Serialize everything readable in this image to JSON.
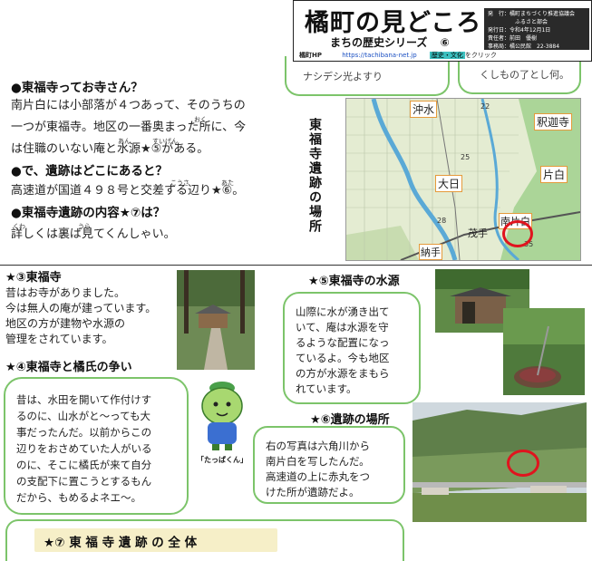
{
  "masthead": {
    "title": "橘町の見どころ",
    "series": "まちの歴史シリーズ",
    "number": "⑥",
    "hp_label": "橘町HP",
    "url": "https://tachibana-net.jp",
    "tag": "歴史・文化",
    "tag_suffix": "をクリック",
    "info": [
      "発　行：橘町まちづくり推進協議会",
      "ふるさと部会",
      "発行日：令和4年12月1日",
      "責任者：前田　優樹",
      "事務局：橘公民館　22-3884"
    ]
  },
  "top_fragments": {
    "left": "ナシデシ光よすり",
    "right": "くしもの了とし何。"
  },
  "intro": {
    "q1_title": "●東福寺ってお寺さん？",
    "q1_line1": "南片白には小部落が４つあって、そのうちの",
    "q1_line2": "一つが東福寺。地区の一番奥まった所に、今",
    "q1_line3": "は住職のいない庵と水源★⑤がある。",
    "q1_ruby_oku": "おく",
    "q1_ruby_an": "あん",
    "q1_ruby_suigen": "すいげん",
    "q2_title": "●で、遺跡はどこにあると？",
    "q2_line1": "高速道が国道４９８号と交差する辺り★⑥。",
    "q2_ruby_kosa": "こうさ",
    "q2_ruby_atari": "あた",
    "q3_title": "●東福寺遺跡の内容★⑦は？",
    "q3_line1": "詳しくは裏ば見てくんしゃい。",
    "q3_ruby_kuwa": "くわ",
    "q3_ruby_ura": "うら"
  },
  "map_label": "東福寺遺跡の場所",
  "map": {
    "places": [
      "沖水",
      "釈迦寺",
      "片白",
      "大日",
      "南片白",
      "納手",
      "茂手"
    ],
    "grid": [
      "22",
      "25",
      "28",
      "35"
    ]
  },
  "sec3": {
    "title": "★③東福寺",
    "lines": [
      "昔はお寺がありました。",
      "今は無人の庵が建っています。",
      "地区の方が建物や水源の",
      "管理をされています。"
    ]
  },
  "sec4": {
    "title": "★④東福寺と橘氏の争い",
    "bubble_lines": [
      "昔は、水田を開いて作付けす",
      "るのに、山水がと～っても大",
      "事だったんだ。以前からこの",
      "辺りをおさめていた人がいる",
      "のに、そこに橘氏が来て自分",
      "の支配下に置こうとするもん",
      "だから、もめるよネエ～。"
    ],
    "mascot_name": "「たっぱくん」"
  },
  "sec5": {
    "title": "★⑤東福寺の水源",
    "bubble_lines": [
      "山際に水が湧き出て",
      "いて、庵は水源を守",
      "るような配置になっ",
      "ているよ。今も地区",
      "の方が水源をまもら",
      "れています。"
    ]
  },
  "sec6": {
    "title": "★⑥遺跡の場所",
    "bubble_lines": [
      "右の写真は六角川から",
      "南片白を写したんだ。",
      "高速道の上に赤丸をつ",
      "けた所が遺跡だよ。"
    ]
  },
  "sec7": {
    "title": "★⑦ 東 福 寺 遺 跡 の 全 体"
  },
  "colors": {
    "accent_green": "#7cc46a",
    "marker_red": "#e0141e",
    "map_road": "#5aa9d6"
  }
}
